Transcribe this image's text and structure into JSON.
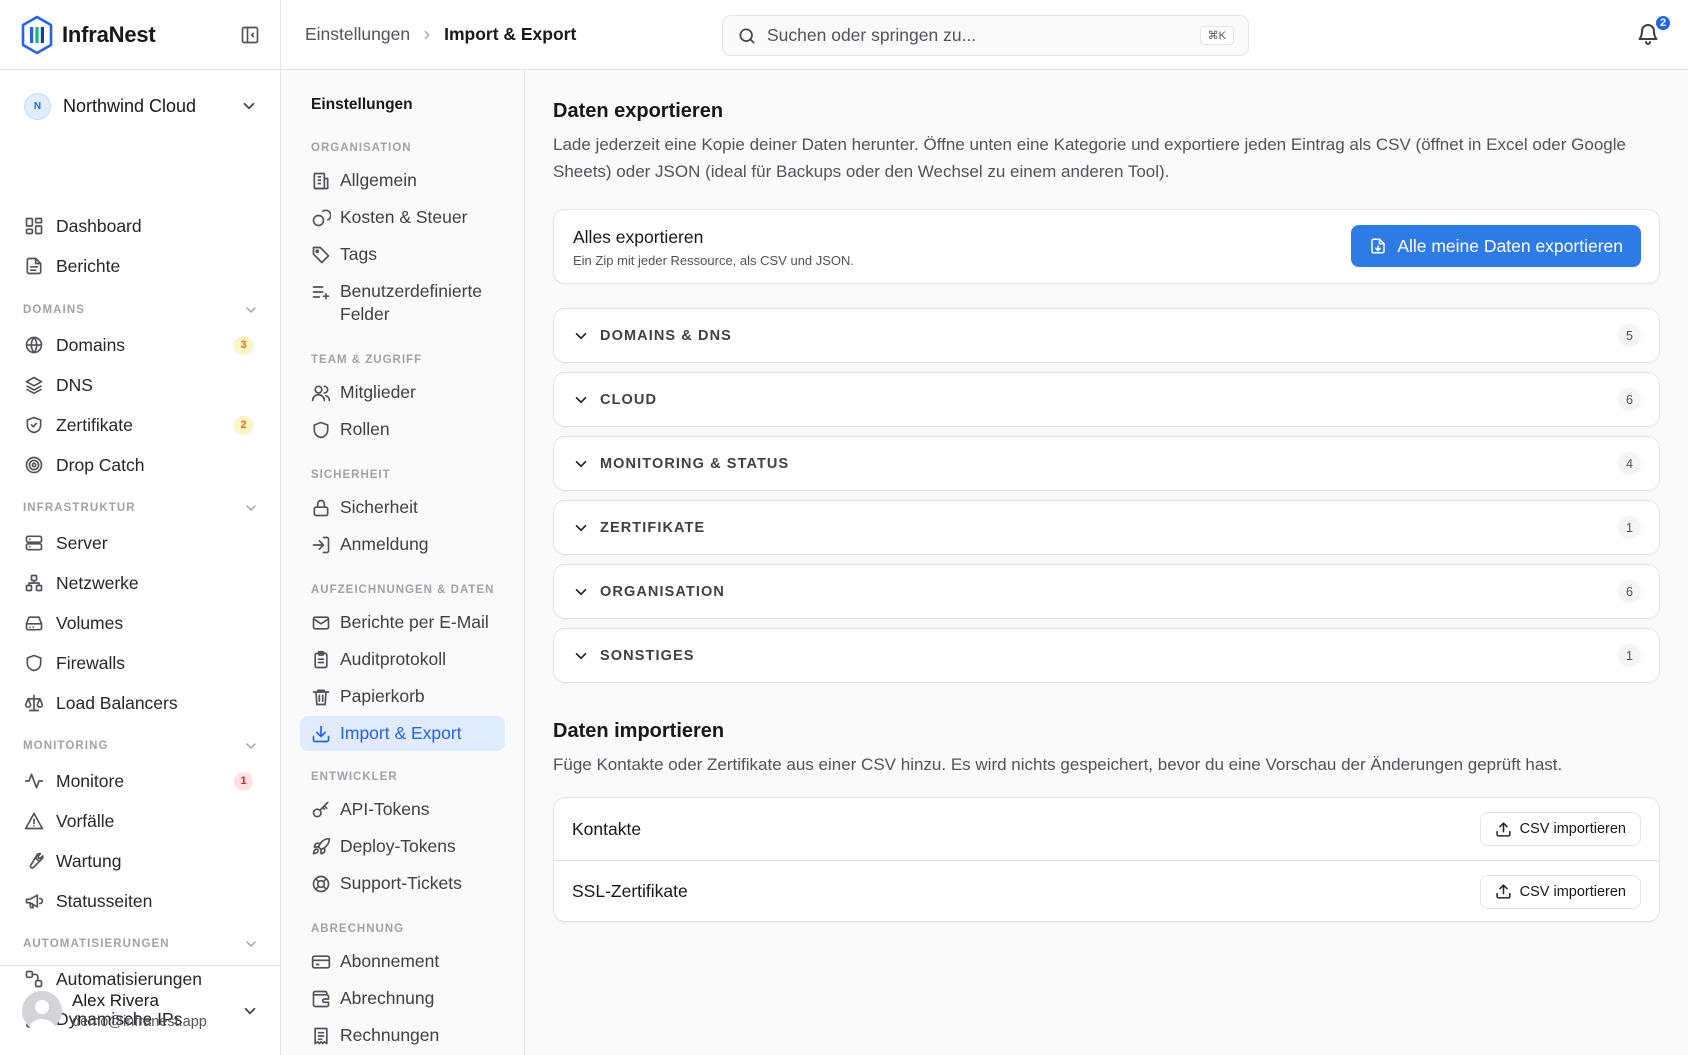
{
  "brand": {
    "name": "InfraNest"
  },
  "org": {
    "initial": "N",
    "name": "Northwind Cloud"
  },
  "nav": {
    "top": [
      {
        "label": "Dashboard",
        "icon": "dashboard-icon"
      },
      {
        "label": "Berichte",
        "icon": "report-icon"
      }
    ],
    "sections": [
      {
        "title": "DOMAINS",
        "items": [
          {
            "label": "Domains",
            "icon": "globe-icon",
            "badge": "3",
            "badge_color": "amber"
          },
          {
            "label": "DNS",
            "icon": "layers-icon"
          },
          {
            "label": "Zertifikate",
            "icon": "shield-check-icon",
            "badge": "2",
            "badge_color": "amber"
          },
          {
            "label": "Drop Catch",
            "icon": "target-icon"
          }
        ]
      },
      {
        "title": "INFRASTRUKTUR",
        "items": [
          {
            "label": "Server",
            "icon": "server-icon"
          },
          {
            "label": "Netzwerke",
            "icon": "network-icon"
          },
          {
            "label": "Volumes",
            "icon": "hard-drive-icon"
          },
          {
            "label": "Firewalls",
            "icon": "shield-icon"
          },
          {
            "label": "Load Balancers",
            "icon": "scale-icon"
          }
        ]
      },
      {
        "title": "MONITORING",
        "items": [
          {
            "label": "Monitore",
            "icon": "activity-icon",
            "badge": "1",
            "badge_color": "red"
          },
          {
            "label": "Vorfälle",
            "icon": "warning-icon"
          },
          {
            "label": "Wartung",
            "icon": "wrench-icon"
          },
          {
            "label": "Statusseiten",
            "icon": "megaphone-icon"
          }
        ]
      },
      {
        "title": "AUTOMATISIERUNGEN",
        "items": [
          {
            "label": "Automatisierungen",
            "icon": "workflow-icon"
          },
          {
            "label": "Dynamische IPs",
            "icon": "route-icon"
          }
        ]
      }
    ]
  },
  "user": {
    "name": "Alex Rivera",
    "email": "demo@infranest.app"
  },
  "breadcrumb": {
    "parent": "Einstellungen",
    "current": "Import & Export"
  },
  "search": {
    "placeholder": "Suchen oder springen zu...",
    "shortcut": "⌘K"
  },
  "notifications": {
    "count": "2"
  },
  "settings_nav": {
    "title": "Einstellungen",
    "sections": [
      {
        "title": "ORGANISATION",
        "items": [
          {
            "label": "Allgemein",
            "icon": "building-icon"
          },
          {
            "label": "Kosten & Steuer",
            "icon": "coins-icon"
          },
          {
            "label": "Tags",
            "icon": "tag-icon"
          },
          {
            "label": "Benutzerdefinierte Felder",
            "icon": "list-plus-icon"
          }
        ]
      },
      {
        "title": "TEAM & ZUGRIFF",
        "items": [
          {
            "label": "Mitglieder",
            "icon": "users-icon"
          },
          {
            "label": "Rollen",
            "icon": "shield-icon"
          }
        ]
      },
      {
        "title": "SICHERHEIT",
        "items": [
          {
            "label": "Sicherheit",
            "icon": "lock-icon"
          },
          {
            "label": "Anmeldung",
            "icon": "login-icon"
          }
        ]
      },
      {
        "title": "AUFZEICHNUNGEN & DATEN",
        "items": [
          {
            "label": "Berichte per E-Mail",
            "icon": "mail-icon"
          },
          {
            "label": "Auditprotokoll",
            "icon": "clipboard-icon"
          },
          {
            "label": "Papierkorb",
            "icon": "trash-icon"
          },
          {
            "label": "Import & Export",
            "icon": "download-icon",
            "active": true
          }
        ]
      },
      {
        "title": "ENTWICKLER",
        "items": [
          {
            "label": "API-Tokens",
            "icon": "key-icon"
          },
          {
            "label": "Deploy-Tokens",
            "icon": "rocket-icon"
          },
          {
            "label": "Support-Tickets",
            "icon": "lifebuoy-icon"
          }
        ]
      },
      {
        "title": "ABRECHNUNG",
        "items": [
          {
            "label": "Abonnement",
            "icon": "credit-card-icon"
          },
          {
            "label": "Abrechnung",
            "icon": "wallet-icon"
          },
          {
            "label": "Rechnungen",
            "icon": "receipt-icon"
          }
        ]
      }
    ]
  },
  "export": {
    "title": "Daten exportieren",
    "description": "Lade jederzeit eine Kopie deiner Daten herunter. Öffne unten eine Kategorie und exportiere jeden Eintrag als CSV (öffnet in Excel oder Google Sheets) oder JSON (ideal für Backups oder den Wechsel zu einem anderen Tool).",
    "all": {
      "title": "Alles exportieren",
      "subtitle": "Ein Zip mit jeder Ressource, als CSV und JSON.",
      "button": "Alle meine Daten exportieren"
    },
    "categories": [
      {
        "label": "DOMAINS & DNS",
        "count": "5"
      },
      {
        "label": "CLOUD",
        "count": "6"
      },
      {
        "label": "MONITORING & STATUS",
        "count": "4"
      },
      {
        "label": "ZERTIFIKATE",
        "count": "1"
      },
      {
        "label": "ORGANISATION",
        "count": "6"
      },
      {
        "label": "SONSTIGES",
        "count": "1"
      }
    ]
  },
  "import": {
    "title": "Daten importieren",
    "description": "Füge Kontakte oder Zertifikate aus einer CSV hinzu. Es wird nichts gespeichert, bevor du eine Vorschau der Änderungen geprüft hast.",
    "rows": [
      {
        "label": "Kontakte",
        "button": "CSV importieren"
      },
      {
        "label": "SSL-Zertifikate",
        "button": "CSV importieren"
      }
    ]
  }
}
